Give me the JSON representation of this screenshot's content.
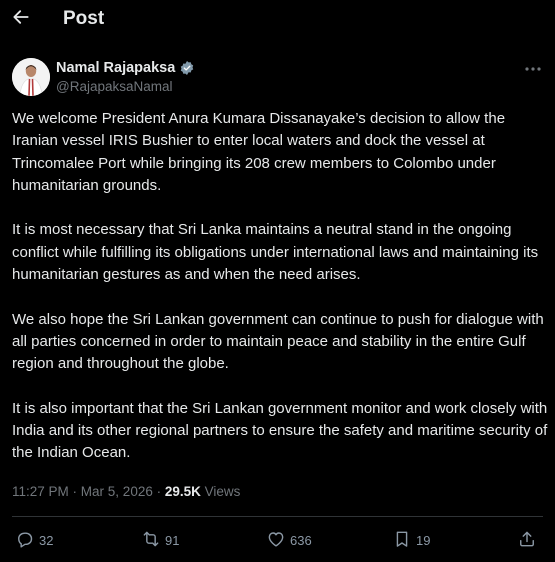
{
  "header": {
    "title": "Post"
  },
  "author": {
    "name": "Namal Rajapaksa",
    "handle": "@RajapaksaNamal"
  },
  "tweet": {
    "paragraphs": [
      "We welcome President Anura Kumara Dissanayake’s decision to allow the Iranian vessel IRIS Bushier to enter local waters and dock the vessel at Trincomalee Port while bringing its 208 crew members to Colombo under humanitarian grounds.",
      "It is most necessary that Sri Lanka maintains a neutral stand in the ongoing conflict while fulfilling its obligations under international laws and maintaining its humanitarian gestures as and when the need arises.",
      "We also hope the Sri Lankan government can continue to push for dialogue with all parties concerned in order to maintain peace and stability in the entire Gulf region and throughout the globe.",
      "It is also important that the Sri Lankan government monitor and work closely with India and its other regional partners to ensure the safety and maritime security of the Indian Ocean."
    ]
  },
  "meta": {
    "time": "11:27 PM",
    "separator": " · ",
    "date": "Mar 5, 2026",
    "separator2": " · ",
    "views_count": "29.5K",
    "views_label": " Views"
  },
  "actions": {
    "replies": "32",
    "reposts": "91",
    "likes": "636",
    "bookmarks": "19"
  },
  "icons": {
    "back": "arrow-left-icon",
    "verified": "verified-badge-icon",
    "more": "more-horizontal-icon",
    "reply": "reply-icon",
    "repost": "repost-icon",
    "like": "heart-icon",
    "bookmark": "bookmark-icon",
    "share": "share-icon"
  },
  "colors": {
    "background": "#000000",
    "text": "#e7e9ea",
    "secondary": "#71767b",
    "verified": "#829aab",
    "divider": "#2f3336"
  }
}
